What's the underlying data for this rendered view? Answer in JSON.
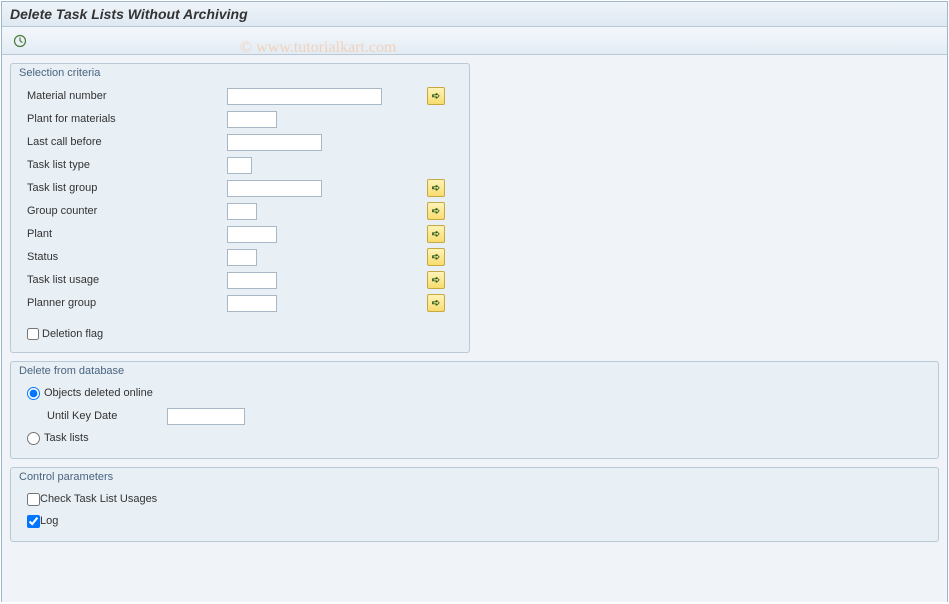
{
  "title": "Delete Task Lists Without Archiving",
  "watermark": "© www.tutorialkart.com",
  "groups": {
    "selection": {
      "title": "Selection criteria",
      "fields": {
        "material_number": "Material number",
        "plant_for_materials": "Plant for materials",
        "last_call_before": "Last call before",
        "task_list_type": "Task list type",
        "task_list_group": "Task list group",
        "group_counter": "Group counter",
        "plant": "Plant",
        "status": "Status",
        "task_list_usage": "Task list usage",
        "planner_group": "Planner group"
      },
      "deletion_flag": "Deletion flag"
    },
    "delete_db": {
      "title": "Delete from database",
      "objects_deleted_online": "Objects deleted online",
      "until_key_date": "Until Key Date",
      "task_lists": "Task lists"
    },
    "control": {
      "title": "Control parameters",
      "check_usages": "Check Task List Usages",
      "log": "Log"
    }
  },
  "values": {
    "material_number": "",
    "plant_for_materials": "",
    "last_call_before": "",
    "task_list_type": "",
    "task_list_group": "",
    "group_counter": "",
    "plant": "",
    "status": "",
    "task_list_usage": "",
    "planner_group": "",
    "until_key_date": "",
    "deletion_flag_checked": false,
    "delete_mode": "online",
    "check_usages_checked": false,
    "log_checked": true
  }
}
